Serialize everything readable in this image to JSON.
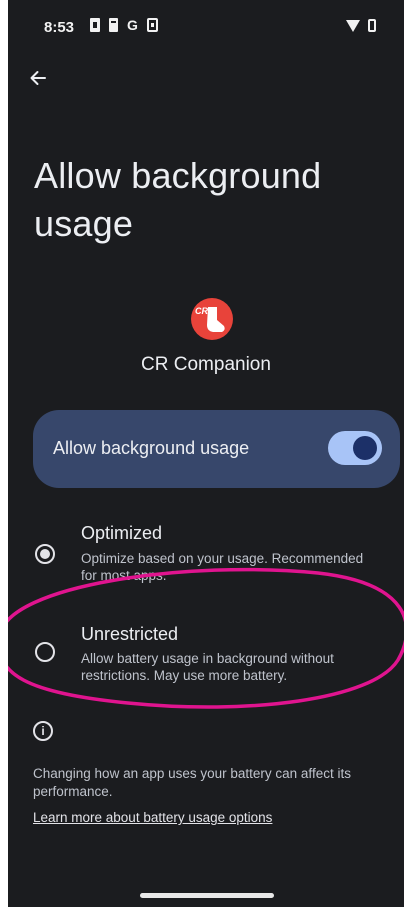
{
  "status_bar": {
    "time": "8:53",
    "g_label": "G",
    "left_icons": [
      "battery-saver-icon",
      "battery-small-icon",
      "g-icon",
      "sim-icon"
    ],
    "right_icons": [
      "wifi-icon",
      "battery-icon"
    ]
  },
  "header": {
    "back_icon": "arrow-left-icon",
    "title": "Allow background usage"
  },
  "app": {
    "icon": "cr-app-icon",
    "icon_tag": "CR",
    "name": "CR Companion",
    "brand_color": "#e8433a"
  },
  "toggle": {
    "label": "Allow background usage",
    "checked": true,
    "card_color": "#37476b",
    "track_color": "#a8c4f7"
  },
  "options": [
    {
      "title": "Optimized",
      "description": "Optimize based on your usage. Recommended for most apps.",
      "selected": true
    },
    {
      "title": "Unrestricted",
      "description": "Allow battery usage in background without restrictions. May use more battery.",
      "selected": false
    }
  ],
  "footer": {
    "info_icon": "info-icon",
    "text": "Changing how an app uses your battery can affect its performance.",
    "link": "Learn more about battery usage options"
  },
  "annotation": {
    "color": "#e0148f",
    "target": "Unrestricted"
  }
}
